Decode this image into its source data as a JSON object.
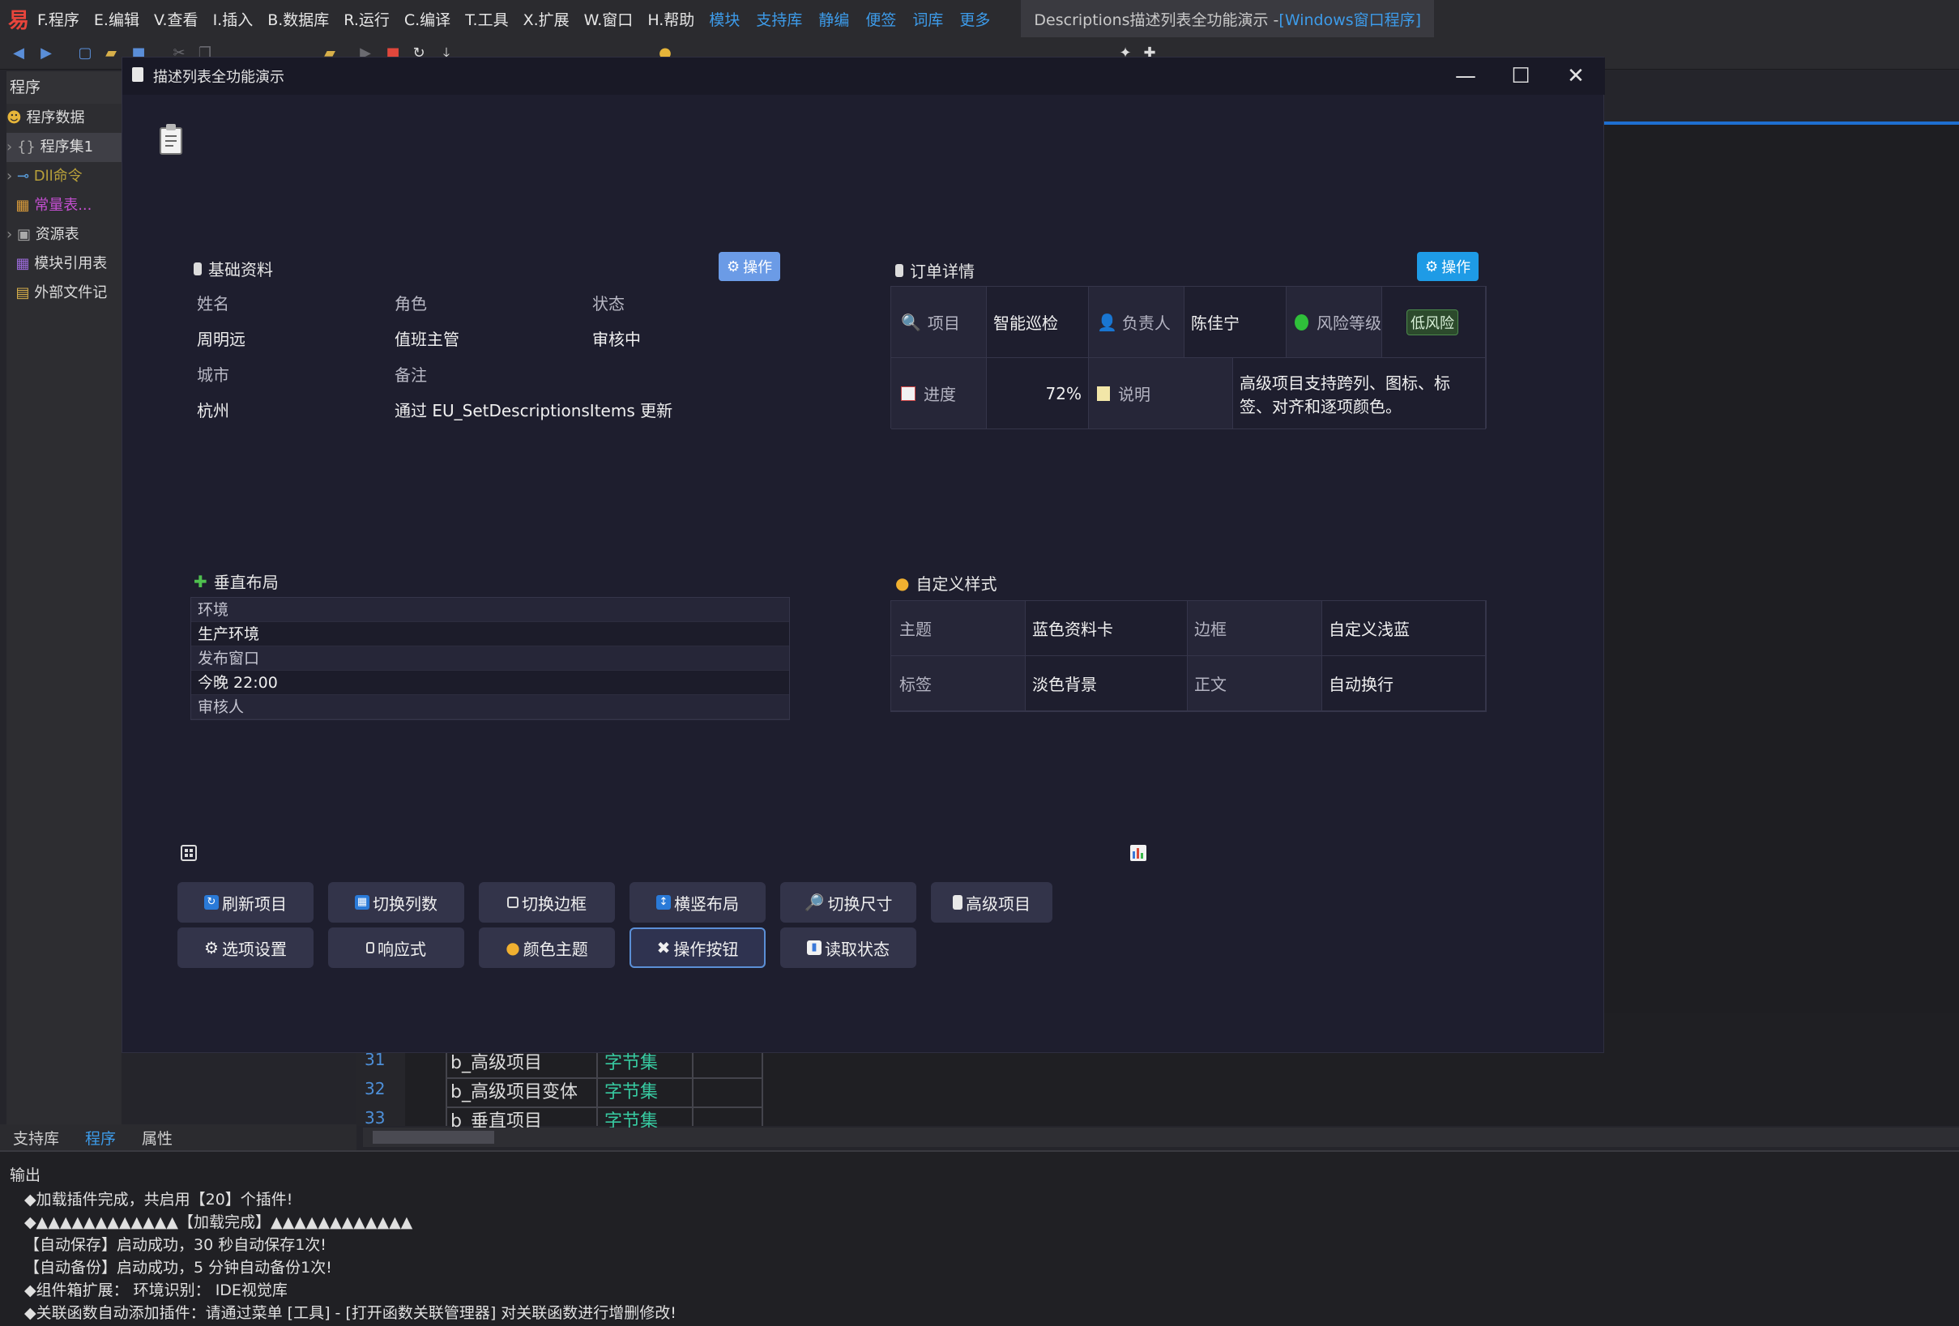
{
  "menubar": {
    "items": [
      "F.程序",
      "E.编辑",
      "V.查看",
      "I.插入",
      "B.数据库",
      "R.运行",
      "C.编译",
      "T.工具",
      "X.扩展",
      "W.窗口",
      "H.帮助"
    ],
    "links": [
      "模块",
      "支持库",
      "静编",
      "便签",
      "词库",
      "更多"
    ],
    "title_prefix": "Descriptions描述列表全功能演示 - ",
    "title_highlight": "[Windows窗口程序]"
  },
  "left_panel": {
    "header": "程序",
    "items": [
      "程序数据",
      "程序集1",
      "Dll命令",
      "常量表...",
      "资源表",
      "模块引用表",
      "外部文件记"
    ]
  },
  "bottom_tabs": [
    "支持库",
    "程序",
    "属性"
  ],
  "code_rows": [
    {
      "line": "31",
      "name": "b_高级项目",
      "type": "字节集"
    },
    {
      "line": "32",
      "name": "b_高级项目变体",
      "type": "字节集"
    },
    {
      "line": "33",
      "name": "b_垂直项目",
      "type": "字节集"
    }
  ],
  "output": {
    "header": "输出",
    "lines": [
      "◆加载插件完成，共启用【20】个插件!",
      "◆▲▲▲▲▲▲▲▲▲▲▲▲【加载完成】▲▲▲▲▲▲▲▲▲▲▲▲",
      "【自动保存】启动成功，30 秒自动保存1次!",
      "【自动备份】启动成功，5 分钟自动备份1次!",
      "◆组件箱扩展：  环境识别：  IDE视觉库",
      "◆关联函数自动添加插件：请通过菜单 [工具] - [打开函数关联管理器] 对关联函数进行增删修改!"
    ]
  },
  "window": {
    "title": "描述列表全功能演示",
    "minimize": "—",
    "maximize": "☐",
    "close": "✕"
  },
  "basic": {
    "title": "基础资料",
    "op_label": "操作",
    "labels": [
      "姓名",
      "角色",
      "状态",
      "城市",
      "备注"
    ],
    "values": [
      "周明远",
      "值班主管",
      "审核中",
      "杭州",
      "通过 EU_SetDescriptionsItems 更新"
    ]
  },
  "order": {
    "title": "订单详情",
    "op_label": "操作",
    "r1": {
      "l1": "项目",
      "v1": "智能巡检",
      "l2": "负责人",
      "v2": "陈佳宁",
      "l3": "风险等级",
      "tag": "低风险"
    },
    "r2": {
      "l1": "进度",
      "v1": "72%",
      "l2": "说明",
      "v2a": "高级项目支持跨列、图标、标",
      "v2b": "签、对齐和逐项颜色。"
    }
  },
  "vertical": {
    "title": "垂直布局",
    "rows": [
      "环境",
      "生产环境",
      "发布窗口",
      "今晚 22:00",
      "审核人"
    ]
  },
  "custom": {
    "title": "自定义样式",
    "r1": [
      "主题",
      "蓝色资料卡",
      "边框",
      "自定义浅蓝"
    ],
    "r2": [
      "标签",
      "淡色背景",
      "正文",
      "自动换行"
    ]
  },
  "actions": {
    "row1": [
      "刷新项目",
      "切换列数",
      "切换边框",
      "横竖布局",
      "切换尺寸",
      "高级项目"
    ],
    "row2": [
      "选项设置",
      "响应式",
      "颜色主题",
      "操作按钮",
      "读取状态"
    ]
  },
  "colors": {
    "accent": "#3d9be9",
    "window_bg": "#1e1e2e",
    "op_button_light": "#6b9be6",
    "op_button_blue": "#1e9be6",
    "risk_dot": "#2fbf3a",
    "tag_bg": "#2c4a2c"
  }
}
